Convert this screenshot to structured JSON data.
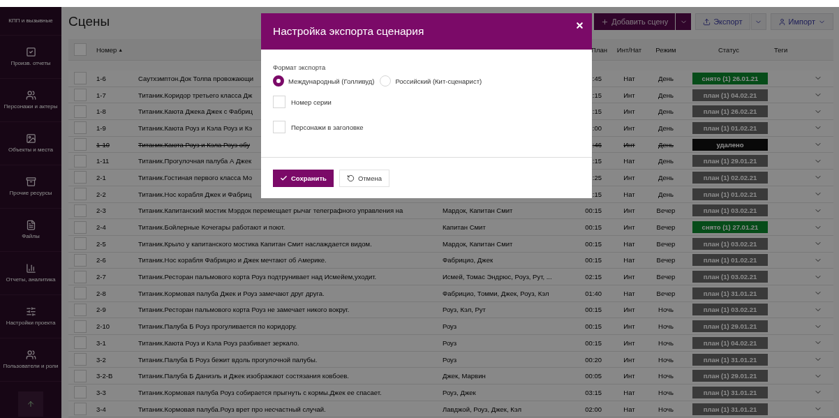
{
  "sidebar": {
    "items": [
      {
        "label": "КПП и вызывные",
        "kind": "top"
      },
      {
        "label": "Произв. отчеты",
        "kind": "check"
      },
      {
        "label": "Персонажи и актеры",
        "kind": "people"
      },
      {
        "label": "Объекты и места",
        "kind": "image"
      },
      {
        "label": "Прочие ресурсы",
        "kind": "archive"
      },
      {
        "label": "Файлы",
        "kind": "file"
      },
      {
        "label": "Отчеты, аналитика",
        "kind": "chart"
      },
      {
        "label": "Настройки проекта",
        "kind": "sliders"
      },
      {
        "label": "Пользователи и роли",
        "kind": "people"
      }
    ]
  },
  "page": {
    "title": "Сцены"
  },
  "toolbar": {
    "add": "Добавить сцену",
    "export": "Экспорт",
    "import": "Импорт"
  },
  "table": {
    "header": {
      "checked": false,
      "number": "Номер",
      "sort_mark": "▲",
      "time": "План",
      "intnat": "Инт/Нат",
      "regime": "Режим",
      "status": "Статус",
      "tags": "Теги"
    },
    "rows": [
      {
        "checked": false,
        "deleted": false,
        "number": "1-6",
        "description": "Саутхэмптон.Док Толпа провожающи",
        "time": ":45",
        "intnat": "Нат",
        "regime": "День",
        "status": {
          "kind": "shot",
          "text": "снято (1) 26.01.21"
        }
      },
      {
        "checked": false,
        "deleted": false,
        "number": "1-7",
        "description": "Титаник.Коридор третьего класса Дж",
        "time": ":15",
        "intnat": "Инт",
        "regime": "День",
        "status": {
          "kind": "planned",
          "text": "план (1) 04.02.21"
        }
      },
      {
        "checked": false,
        "deleted": false,
        "number": "1-8",
        "description": "Титаник.Каюта Джека Джек с Фабриц",
        "time": ":15",
        "intnat": "Инт",
        "regime": "День",
        "status": {
          "kind": "planned",
          "text": "план (1) 26.02.21"
        }
      },
      {
        "checked": false,
        "deleted": false,
        "number": "1-9",
        "description": "Титаник.Каюта Роуз и Кэла Роуз и Кэ",
        "time": ":00",
        "intnat": "Инт",
        "regime": "День",
        "status": {
          "kind": "planned",
          "text": "план (1) 01.02.21"
        }
      },
      {
        "checked": false,
        "deleted": true,
        "number": "1-10",
        "description": "Титаник.Каюта Роуз и Кэла Роуз обу",
        "time": ":46",
        "intnat": "Инт",
        "regime": "День",
        "status": {
          "kind": "deleted",
          "text": "удалено"
        }
      },
      {
        "checked": false,
        "deleted": false,
        "number": "1-11",
        "description": "Титаник.Прогулочная палуба А Джек",
        "time": ":15",
        "intnat": "Нат",
        "regime": "День",
        "status": {
          "kind": "planned",
          "text": "план (1) 29.01.21"
        }
      },
      {
        "checked": false,
        "deleted": false,
        "number": "2-1",
        "description": "Титаник.Гостиная первого класса Мо",
        "time": ":25",
        "intnat": "Инт",
        "regime": "День",
        "status": {
          "kind": "planned",
          "text": "план (1) 02.02.21"
        }
      },
      {
        "checked": false,
        "deleted": false,
        "number": "2-2",
        "description": "Титаник.Нос корабля Джек и Фабриц",
        "time": ":15",
        "intnat": "Нат",
        "regime": "День",
        "status": {
          "kind": "planned",
          "text": "план (1) 01.02.21"
        }
      },
      {
        "checked": false,
        "deleted": false,
        "number": "2-3",
        "description": "Титаник.Капитанский мостик Мэрдок перемещает рычаг телеграфного управления на",
        "characters": "Мардок, Капитан Смит",
        "time": "00:15",
        "intnat": "Инт",
        "regime": "Вечер",
        "status": {
          "kind": "planned",
          "text": "план (1) 03.02.21"
        }
      },
      {
        "checked": false,
        "deleted": false,
        "number": "2-4",
        "description": "Титаник.Бойлерные Кочегары работают и поют.",
        "characters": "Капитан Смит",
        "time": "00:15",
        "intnat": "Инт",
        "regime": "Вечер",
        "status": {
          "kind": "shot",
          "text": "снято (1) 27.01.21"
        }
      },
      {
        "checked": false,
        "deleted": false,
        "number": "2-5",
        "description": "Титаник.Крыло у капитанского мостика Капитан Смит наслаждается видом.",
        "characters": "Мардок, Капитан Смит",
        "time": "00:15",
        "intnat": "Нат",
        "regime": "Вечер",
        "status": {
          "kind": "planned",
          "text": "план (1) 03.02.21"
        }
      },
      {
        "checked": false,
        "deleted": false,
        "number": "2-6",
        "description": "Титаник.Нос корабля Фабрицио и Джек мечтают об Америке.",
        "characters": "Фабрицио, Джек",
        "time": "00:15",
        "intnat": "Нат",
        "regime": "Вечер",
        "status": {
          "kind": "planned",
          "text": "план (1) 01.02.21"
        }
      },
      {
        "checked": false,
        "deleted": false,
        "number": "2-7",
        "description": "Титаник.Ресторан пальмового корта Роуз подтрунивает над Исмейем,уходит.",
        "characters": "Исмей, Томас Эндрюс, Роуз, Рут, ...",
        "time": "02:15",
        "intnat": "Инт",
        "regime": "Вечер",
        "status": {
          "kind": "planned",
          "text": "план (1) 03.02.21"
        }
      },
      {
        "checked": false,
        "deleted": false,
        "number": "2-8",
        "description": "Титаник.Кормовая палуба Джек и Роуз замечают друг друга.",
        "characters": "Фабрицио, Томми, Джек, Роуз, Кэл",
        "time": "01:40",
        "intnat": "Нат",
        "regime": "Вечер",
        "status": {
          "kind": "planned",
          "text": "план (1) 31.01.21"
        }
      },
      {
        "checked": false,
        "deleted": false,
        "number": "2-9",
        "description": "Титаник.Ресторан пальмового корта Роуз не замечает никого вокруг.",
        "characters": "Роуз, Кэл, Рут",
        "time": "00:15",
        "intnat": "Инт",
        "regime": "Ночь",
        "status": {
          "kind": "planned",
          "text": "план (1) 03.02.21"
        }
      },
      {
        "checked": false,
        "deleted": false,
        "number": "2-10",
        "description": "Титаник.Палуба Б Роуз прогуливается по коридору.",
        "characters": "Роуз",
        "time": "00:15",
        "intnat": "Инт",
        "regime": "Ночь",
        "status": {
          "kind": "planned",
          "text": "план (1) 29.01.21"
        }
      },
      {
        "checked": false,
        "deleted": false,
        "number": "3-1",
        "description": "Титаник.Каюта Роуз и Кэла Роуз разбивает зеркало.",
        "characters": "Роуз",
        "time": "00:15",
        "intnat": "Инт",
        "regime": "Ночь",
        "status": {
          "kind": "planned",
          "text": "план (1) 04.02.21"
        }
      },
      {
        "checked": false,
        "deleted": false,
        "number": "3-2",
        "description": "Титаник.Палуба Б Роуз бежит вдоль прогулочной палубы.",
        "characters": "Роуз",
        "time": "00:20",
        "intnat": "Инт",
        "regime": "Ночь",
        "status": {
          "kind": "planned",
          "text": "план (1) 31.01.21"
        }
      },
      {
        "checked": false,
        "deleted": false,
        "number": "3-2-В",
        "description": "Титаник.Палуба Б Даниэль и Джек изображают состязания ковбоев.",
        "characters": "Джек, Марвин",
        "time": "00:05",
        "intnat": "Инт",
        "regime": "Ночь",
        "status": {
          "kind": "planned",
          "text": "план (1) 29.01.21"
        }
      },
      {
        "checked": false,
        "deleted": false,
        "number": "3-3",
        "description": "Титаник.Кормовая палуба Роуз собирается прыгнуть с кормы.Джек ее спасает.",
        "characters": "Роуз, Джек",
        "time": "03:15",
        "intnat": "Нат",
        "regime": "Ночь",
        "status": {
          "kind": "planned",
          "text": "план (1) 31.01.21"
        }
      },
      {
        "checked": false,
        "deleted": false,
        "number": "3-4",
        "description": "Титаник.Кормовая палуба.Роуз врет про несчастный случай.",
        "characters": "Лавджой, Роуз, Джек, Кэл",
        "time": "02:00",
        "intnat": "Нат",
        "regime": "Ночь",
        "status": {
          "kind": "planned",
          "text": "план (1) 31.01.21"
        }
      }
    ]
  },
  "dialog": {
    "title": "Настройка экспорта сценария",
    "format_label": "Формат экспорта",
    "formats": [
      {
        "label": "Международный (Голливуд)",
        "selected": true
      },
      {
        "label": "Российский (Кит-сценарист)",
        "selected": false
      }
    ],
    "options": [
      {
        "label": "Номер серии",
        "checked": false
      },
      {
        "label": "Персонажи в заголовке",
        "checked": false
      }
    ],
    "save": "Сохранить",
    "cancel": "Отмена"
  }
}
